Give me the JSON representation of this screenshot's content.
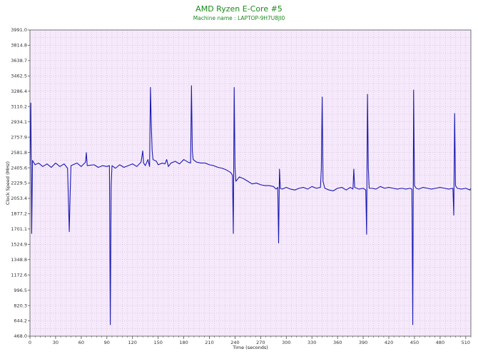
{
  "title": "AMD Ryzen E-Core #5",
  "subtitle": "Machine name : LAPTOP-9H7U8JI0",
  "colors": {
    "plot_background": "#f6e9fb",
    "line": "#1a1ab4",
    "grid": "#b8a8bc",
    "title": "#1a8a1a"
  },
  "chart_data": {
    "type": "line",
    "title": "AMD Ryzen E-Core #5",
    "subtitle": "Machine name : LAPTOP-9H7U8JI0",
    "xlabel": "Time (seconds)",
    "ylabel": "Clock Speed (MHz)",
    "xlim": [
      0,
      516
    ],
    "ylim": [
      468.0,
      3991.0
    ],
    "grid": true,
    "legend": "none",
    "x_ticks": [
      "0",
      "30",
      "60",
      "90",
      "120",
      "150",
      "180",
      "210",
      "240",
      "270",
      "300",
      "330",
      "360",
      "390",
      "420",
      "450",
      "480",
      "510"
    ],
    "y_ticks": [
      "468.0",
      "644.2",
      "820.3",
      "996.5",
      "1172.6",
      "1348.8",
      "1524.9",
      "1701.1",
      "1877.2",
      "2053.4",
      "2229.5",
      "2405.6",
      "2581.8",
      "2757.9",
      "2934.1",
      "3110.2",
      "3286.4",
      "3462.5",
      "3638.7",
      "3814.8",
      "3991.0"
    ],
    "series": [
      {
        "values": [
          [
            0,
            2440
          ],
          [
            1,
            3150
          ],
          [
            2,
            1650
          ],
          [
            3,
            2490
          ],
          [
            6,
            2440
          ],
          [
            10,
            2460
          ],
          [
            15,
            2420
          ],
          [
            20,
            2450
          ],
          [
            25,
            2410
          ],
          [
            30,
            2460
          ],
          [
            35,
            2420
          ],
          [
            40,
            2450
          ],
          [
            44,
            2400
          ],
          [
            46,
            1670
          ],
          [
            47,
            2100
          ],
          [
            48,
            2430
          ],
          [
            55,
            2460
          ],
          [
            60,
            2420
          ],
          [
            65,
            2470
          ],
          [
            66,
            2580
          ],
          [
            67,
            2430
          ],
          [
            75,
            2440
          ],
          [
            80,
            2410
          ],
          [
            85,
            2430
          ],
          [
            90,
            2420
          ],
          [
            93,
            2430
          ],
          [
            94,
            600
          ],
          [
            95,
            2200
          ],
          [
            96,
            2430
          ],
          [
            100,
            2400
          ],
          [
            105,
            2440
          ],
          [
            110,
            2410
          ],
          [
            115,
            2430
          ],
          [
            120,
            2450
          ],
          [
            125,
            2420
          ],
          [
            130,
            2470
          ],
          [
            132,
            2600
          ],
          [
            133,
            2460
          ],
          [
            135,
            2430
          ],
          [
            138,
            2500
          ],
          [
            140,
            2420
          ],
          [
            141,
            3330
          ],
          [
            142,
            2900
          ],
          [
            143,
            2600
          ],
          [
            144,
            2500
          ],
          [
            148,
            2480
          ],
          [
            150,
            2440
          ],
          [
            155,
            2460
          ],
          [
            158,
            2450
          ],
          [
            160,
            2500
          ],
          [
            162,
            2420
          ],
          [
            165,
            2460
          ],
          [
            170,
            2480
          ],
          [
            175,
            2450
          ],
          [
            180,
            2500
          ],
          [
            185,
            2470
          ],
          [
            188,
            2460
          ],
          [
            189,
            3350
          ],
          [
            190,
            2600
          ],
          [
            191,
            2500
          ],
          [
            195,
            2470
          ],
          [
            200,
            2460
          ],
          [
            205,
            2460
          ],
          [
            210,
            2440
          ],
          [
            215,
            2430
          ],
          [
            220,
            2410
          ],
          [
            225,
            2400
          ],
          [
            230,
            2380
          ],
          [
            235,
            2350
          ],
          [
            237,
            2320
          ],
          [
            238,
            1650
          ],
          [
            239,
            3330
          ],
          [
            240,
            2400
          ],
          [
            241,
            2250
          ],
          [
            245,
            2300
          ],
          [
            250,
            2280
          ],
          [
            255,
            2250
          ],
          [
            260,
            2220
          ],
          [
            265,
            2230
          ],
          [
            270,
            2210
          ],
          [
            275,
            2200
          ],
          [
            280,
            2200
          ],
          [
            285,
            2190
          ],
          [
            288,
            2160
          ],
          [
            290,
            2180
          ],
          [
            291,
            1540
          ],
          [
            292,
            2390
          ],
          [
            293,
            2170
          ],
          [
            295,
            2160
          ],
          [
            300,
            2180
          ],
          [
            305,
            2160
          ],
          [
            310,
            2150
          ],
          [
            315,
            2170
          ],
          [
            320,
            2180
          ],
          [
            325,
            2160
          ],
          [
            330,
            2190
          ],
          [
            335,
            2170
          ],
          [
            340,
            2180
          ],
          [
            341,
            2400
          ],
          [
            342,
            3220
          ],
          [
            343,
            2250
          ],
          [
            345,
            2170
          ],
          [
            350,
            2150
          ],
          [
            355,
            2140
          ],
          [
            360,
            2170
          ],
          [
            365,
            2180
          ],
          [
            370,
            2150
          ],
          [
            375,
            2180
          ],
          [
            378,
            2160
          ],
          [
            379,
            2390
          ],
          [
            380,
            2180
          ],
          [
            385,
            2160
          ],
          [
            390,
            2170
          ],
          [
            393,
            2150
          ],
          [
            394,
            1640
          ],
          [
            395,
            3250
          ],
          [
            396,
            2400
          ],
          [
            397,
            2170
          ],
          [
            400,
            2170
          ],
          [
            405,
            2160
          ],
          [
            410,
            2190
          ],
          [
            415,
            2170
          ],
          [
            420,
            2180
          ],
          [
            425,
            2170
          ],
          [
            430,
            2160
          ],
          [
            435,
            2170
          ],
          [
            440,
            2160
          ],
          [
            445,
            2170
          ],
          [
            447,
            2160
          ],
          [
            448,
            600
          ],
          [
            449,
            3300
          ],
          [
            450,
            2200
          ],
          [
            452,
            2170
          ],
          [
            455,
            2160
          ],
          [
            460,
            2180
          ],
          [
            465,
            2170
          ],
          [
            470,
            2160
          ],
          [
            475,
            2170
          ],
          [
            480,
            2180
          ],
          [
            485,
            2170
          ],
          [
            490,
            2160
          ],
          [
            495,
            2170
          ],
          [
            496,
            1860
          ],
          [
            497,
            3030
          ],
          [
            498,
            2200
          ],
          [
            500,
            2170
          ],
          [
            505,
            2160
          ],
          [
            510,
            2170
          ],
          [
            515,
            2150
          ],
          [
            516,
            2170
          ]
        ]
      }
    ]
  }
}
